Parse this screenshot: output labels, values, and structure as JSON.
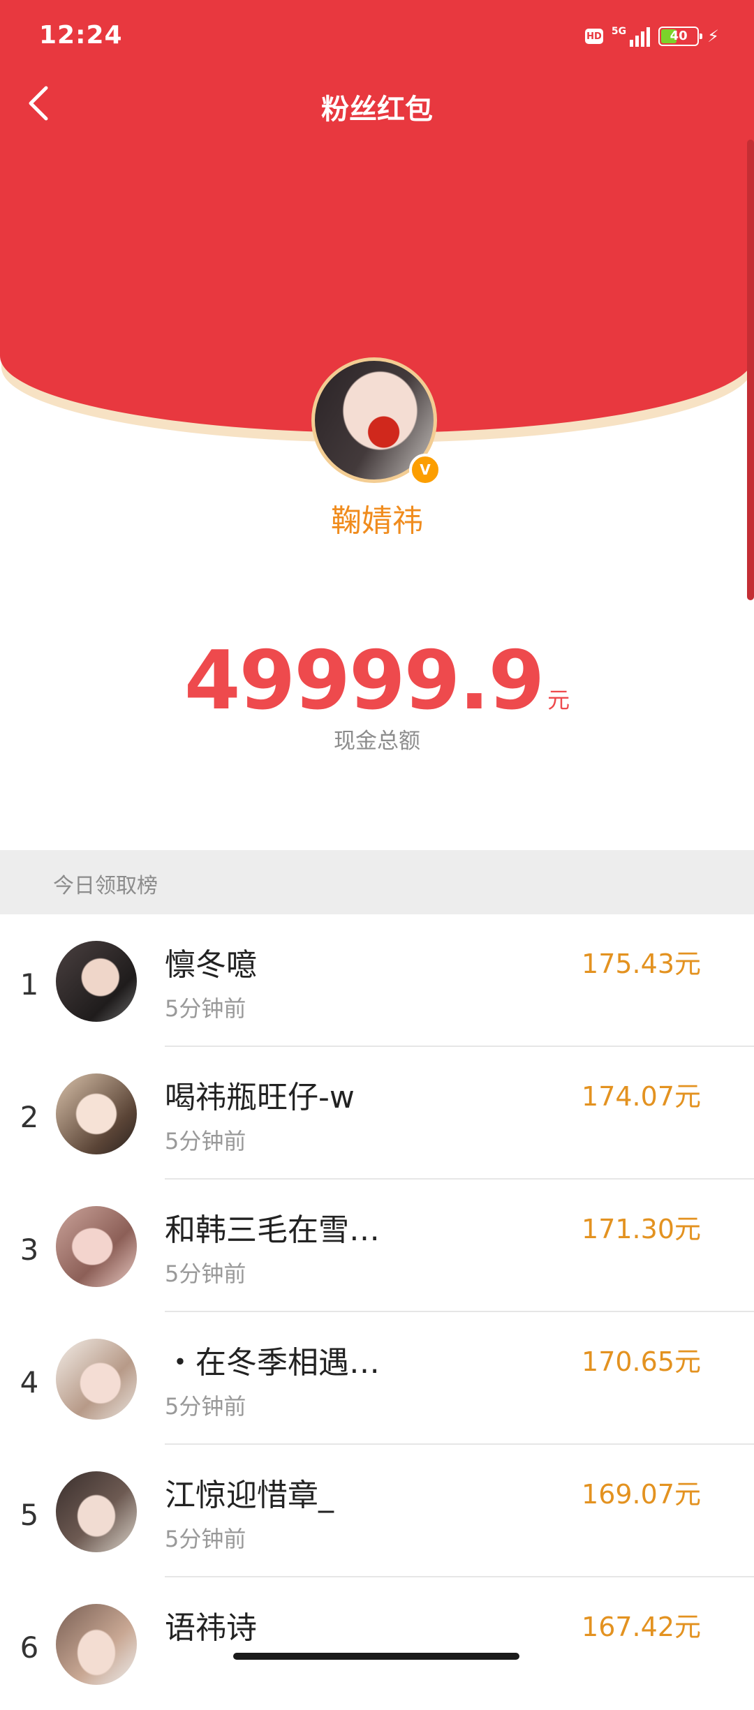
{
  "status_bar": {
    "time": "12:24",
    "hd_label": "HD",
    "network_label": "5G",
    "battery_level": "40",
    "icons": [
      "hd-icon",
      "signal-icon",
      "battery-icon",
      "charging-bolt-icon"
    ]
  },
  "header": {
    "title": "粉丝红包",
    "back_icon": "chevron-left-icon"
  },
  "profile": {
    "name": "鞠婧祎",
    "verified_badge": "V"
  },
  "amount": {
    "value": "49999.9",
    "unit": "元",
    "label": "现金总额"
  },
  "ranking": {
    "title": "今日领取榜",
    "rows": [
      {
        "rank": "1",
        "name": "懔冬噫",
        "time": "5分钟前",
        "amount": "175.43元"
      },
      {
        "rank": "2",
        "name": "喝祎瓶旺仔-w",
        "time": "5分钟前",
        "amount": "174.07元"
      },
      {
        "rank": "3",
        "name": "和韩三毛在雪…",
        "time": "5分钟前",
        "amount": "171.30元"
      },
      {
        "rank": "4",
        "name": "・在冬季相遇…",
        "time": "5分钟前",
        "amount": "170.65元"
      },
      {
        "rank": "5",
        "name": "江惊迎惜章_",
        "time": "5分钟前",
        "amount": "169.07元"
      },
      {
        "rank": "6",
        "name": "语祎诗",
        "time": "",
        "amount": "167.42元"
      }
    ]
  },
  "colors": {
    "header_red": "#e8383f",
    "amount_red": "#ee4a4d",
    "name_orange": "#f08c1e",
    "reward_orange": "#e39220"
  }
}
